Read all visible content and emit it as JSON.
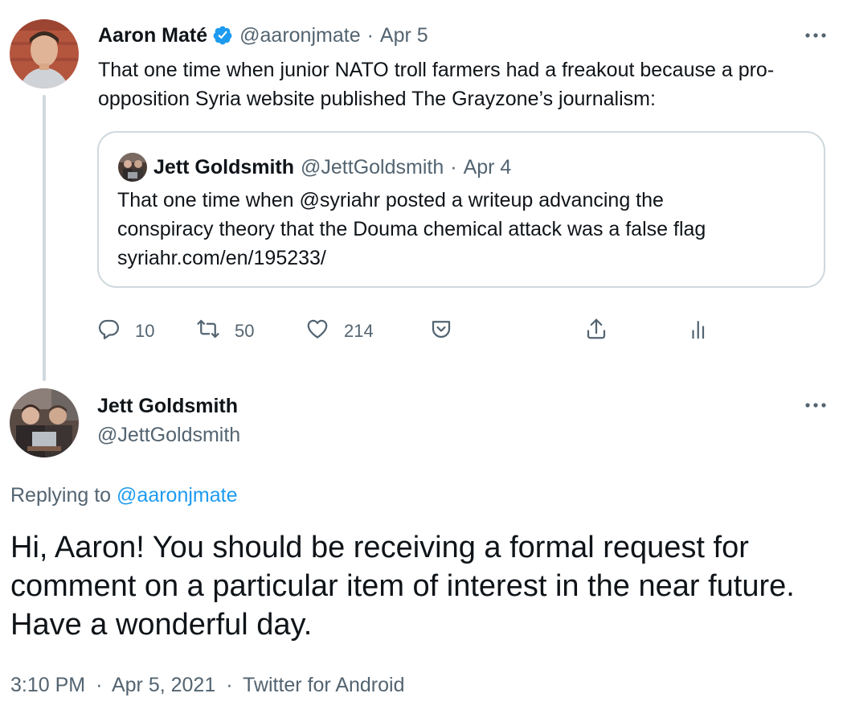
{
  "parent_tweet": {
    "author": {
      "name": "Aaron Maté",
      "handle": "@aaronjmate",
      "verified": true
    },
    "date": "Apr 5",
    "dot": "·",
    "text": "That one time when junior NATO troll farmers had a freakout because a pro-opposition Syria website published The Grayzone’s journalism:",
    "quoted_tweet": {
      "author": {
        "name": "Jett Goldsmith",
        "handle": "@JettGoldsmith"
      },
      "date": "Apr 4",
      "dot": "·",
      "text_line1": "That one time when @syriahr posted a writeup advancing the",
      "text_line2": "conspiracy theory that the Douma chemical attack was a false flag",
      "link": "syriahr.com/en/195233/"
    },
    "actions": {
      "replies": "10",
      "retweets": "50",
      "likes": "214"
    },
    "icons": [
      "verified-badge-icon",
      "more-icon",
      "reply-icon",
      "retweet-icon",
      "like-icon",
      "bookmark-icon",
      "share-icon",
      "analytics-icon"
    ]
  },
  "reply_tweet": {
    "author": {
      "name": "Jett Goldsmith",
      "handle": "@JettGoldsmith"
    },
    "replying_label": "Replying to",
    "replying_to": "@aaronjmate",
    "text": "Hi, Aaron! You should be receiving a formal request for comment on a particular item of interest in the near future. Have a wonderful day.",
    "time": "3:10 PM",
    "date": "Apr 5, 2021",
    "source": "Twitter for Android",
    "dot": "·"
  },
  "colors": {
    "text": "#0f1419",
    "muted": "#536471",
    "accent": "#1d9bf0",
    "border": "#cfd9de"
  }
}
